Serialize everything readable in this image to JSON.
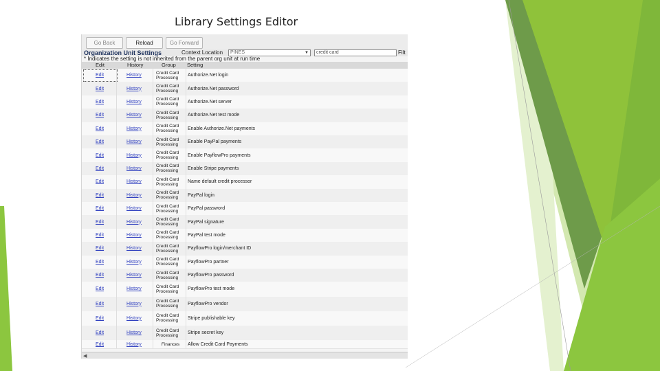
{
  "slide": {
    "title": "Library Settings Editor"
  },
  "nav": {
    "back": "Go Back",
    "reload": "Reload",
    "forward": "Go Forward"
  },
  "filter": {
    "title": "Organization Unit Settings",
    "context_label": "Context Location",
    "context_value": "PINES",
    "filter_value": "credit card",
    "filter_button": "Filt"
  },
  "note": "* Indicates the setting is not inherited from the parent org unit at run time",
  "columns": {
    "edit": "Edit",
    "history": "History",
    "group": "Group",
    "setting": "Setting"
  },
  "rows": [
    {
      "edit": "Edit",
      "history": "History",
      "group": "Credit Card Processing",
      "setting": "Authorize.Net login"
    },
    {
      "edit": "Edit",
      "history": "History",
      "group": "Credit Card Processing",
      "setting": "Authorize.Net password"
    },
    {
      "edit": "Edit",
      "history": "History",
      "group": "Credit Card Processing",
      "setting": "Authorize.Net server"
    },
    {
      "edit": "Edit",
      "history": "History",
      "group": "Credit Card Processing",
      "setting": "Authorize.Net test mode"
    },
    {
      "edit": "Edit",
      "history": "History",
      "group": "Credit Card Processing",
      "setting": "Enable Authorize.Net payments"
    },
    {
      "edit": "Edit",
      "history": "History",
      "group": "Credit Card Processing",
      "setting": "Enable PayPal payments"
    },
    {
      "edit": "Edit",
      "history": "History",
      "group": "Credit Card Processing",
      "setting": "Enable PayflowPro payments"
    },
    {
      "edit": "Edit",
      "history": "History",
      "group": "Credit Card Processing",
      "setting": "Enable Stripe payments"
    },
    {
      "edit": "Edit",
      "history": "History",
      "group": "Credit Card Processing",
      "setting": "Name default credit processor"
    },
    {
      "edit": "Edit",
      "history": "History",
      "group": "Credit Card Processing",
      "setting": "PayPal login"
    },
    {
      "edit": "Edit",
      "history": "History",
      "group": "Credit Card Processing",
      "setting": "PayPal password"
    },
    {
      "edit": "Edit",
      "history": "History",
      "group": "Credit Card Processing",
      "setting": "PayPal signature"
    },
    {
      "edit": "Edit",
      "history": "History",
      "group": "Credit Card Processing",
      "setting": "PayPal test mode"
    },
    {
      "edit": "Edit",
      "history": "History",
      "group": "Credit Card Processing",
      "setting": "PayflowPro login/merchant ID"
    },
    {
      "edit": "Edit",
      "history": "History",
      "group": "Credit Card Processing",
      "setting": "PayflowPro partner"
    },
    {
      "edit": "Edit",
      "history": "History",
      "group": "Credit Card Processing",
      "setting": "PayflowPro password"
    },
    {
      "edit": "Edit",
      "history": "History",
      "group": "Credit Card Processing",
      "setting": "PayflowPro test mode"
    },
    {
      "edit": "Edit",
      "history": "History",
      "group": "Credit Card Processing",
      "setting": "PayflowPro vendor"
    },
    {
      "edit": "Edit",
      "history": "History",
      "group": "Credit Card Processing",
      "setting": "Stripe publishable key"
    },
    {
      "edit": "Edit",
      "history": "History",
      "group": "Credit Card Processing",
      "setting": "Stripe secret key"
    },
    {
      "edit": "Edit",
      "history": "History",
      "group": "Finances",
      "setting": "Allow Credit Card Payments"
    }
  ]
}
